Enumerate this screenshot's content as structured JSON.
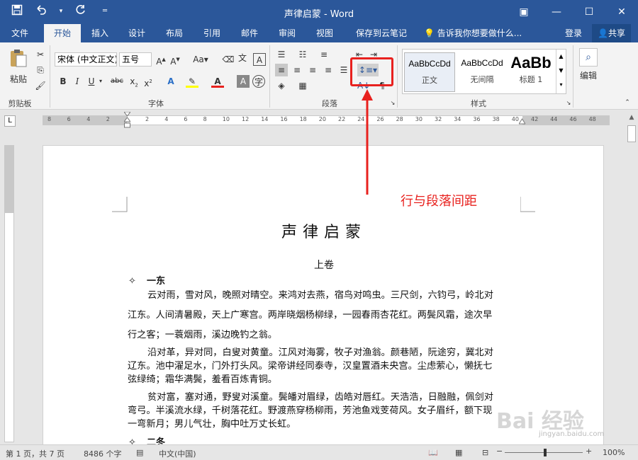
{
  "window": {
    "title": "声律启蒙 - Word"
  },
  "qat": {
    "save_icon": "save-icon",
    "undo_icon": "undo-icon",
    "redo_icon": "redo-icon",
    "customize_icon": "customize-icon"
  },
  "tabs": [
    {
      "label": "文件"
    },
    {
      "label": "开始"
    },
    {
      "label": "插入"
    },
    {
      "label": "设计"
    },
    {
      "label": "布局"
    },
    {
      "label": "引用"
    },
    {
      "label": "邮件"
    },
    {
      "label": "审阅"
    },
    {
      "label": "视图"
    },
    {
      "label": "保存到云笔记"
    },
    {
      "label": "告诉我你想要做什么..."
    }
  ],
  "account": {
    "login": "登录",
    "share": "共享"
  },
  "ribbon": {
    "clipboard": {
      "label": "剪贴板",
      "paste": "粘贴"
    },
    "font": {
      "label": "字体",
      "name": "宋体 (中文正文)",
      "size": "五号"
    },
    "paragraph": {
      "label": "段落"
    },
    "styles": {
      "label": "样式",
      "items": [
        {
          "preview": "AaBbCcDd",
          "name": "正文"
        },
        {
          "preview": "AaBbCcDd",
          "name": "无间隔"
        },
        {
          "preview": "AaBb",
          "name": "标题 1"
        }
      ]
    },
    "editing": {
      "label": "编辑"
    }
  },
  "annotation": {
    "text": "行与段落间距",
    "color": "#e8211e"
  },
  "ruler": {
    "labels": [
      "8",
      "6",
      "4",
      "2",
      "2",
      "4",
      "6",
      "8",
      "10",
      "12",
      "14",
      "16",
      "18",
      "20",
      "22",
      "24",
      "26",
      "28",
      "30",
      "32",
      "34",
      "36",
      "38",
      "40",
      "42",
      "44",
      "46",
      "48"
    ]
  },
  "document": {
    "title": "声律启蒙",
    "subtitle": "上卷",
    "sections": [
      {
        "heading": "一东",
        "symbol": "✧"
      },
      {
        "heading": "二冬",
        "symbol": "✧"
      }
    ],
    "paragraphs": [
      {
        "lines": [
          "云对雨，雪对风，晚照对晴空。来鸿对去燕，宿鸟对鸣虫。三尺剑，六钧弓，岭北对",
          "江东。人间清暑殿，天上广寒宫。两岸晓烟杨柳绿，一园春雨杏花红。两鬓风霜，途次早",
          "行之客；一蓑烟雨，溪边晚钓之翁。"
        ]
      },
      {
        "lines": [
          "沿对革，异对同，白叟对黄童。江风对海雾，牧子对渔翁。颜巷陋，阮途穷，冀北对",
          "辽东。池中濯足水，门外打头风。梁帝讲经同泰寺，汉皇置酒未央宫。尘虑萦心，懒抚七",
          "弦绿绮；霜华满鬓，羞看百炼青铜。"
        ]
      },
      {
        "lines": [
          "贫对富，塞对通，野叟对溪童。鬓皤对眉绿，齿皓对唇红。天浩浩，日融融，佩剑对",
          "弯弓。半溪流水绿，千树落花红。野渡燕穿杨柳雨，芳池鱼戏芰荷风。女子眉纤，额下现",
          "一弯新月；男儿气壮，胸中吐万丈长虹。"
        ]
      }
    ]
  },
  "status": {
    "page": "第 1 页，共 7 页",
    "words": "8486 个字",
    "lang": "中文(中国)",
    "zoom": "100%"
  },
  "watermark": {
    "text": "Bai 经验",
    "sub": "jingyan.baidu.com"
  }
}
